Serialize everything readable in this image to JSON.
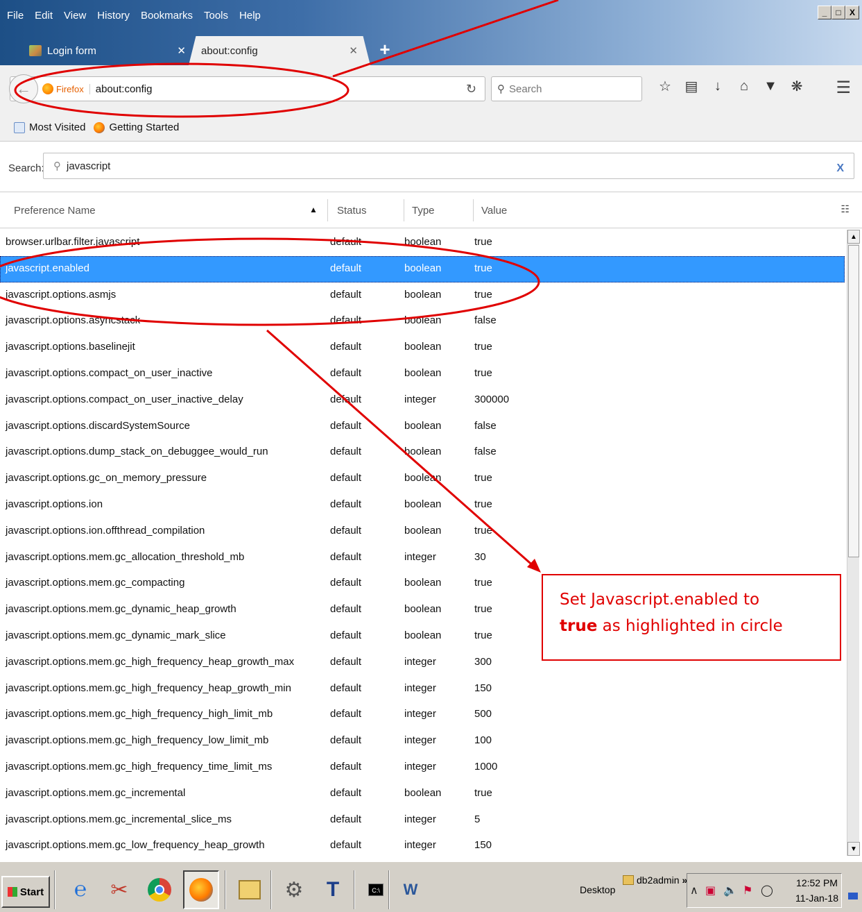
{
  "window": {
    "menus": [
      "File",
      "Edit",
      "View",
      "History",
      "Bookmarks",
      "Tools",
      "Help"
    ],
    "controls": [
      "_",
      "□",
      "X"
    ]
  },
  "tabs": [
    {
      "title": "Login form",
      "active": false
    },
    {
      "title": "about:config",
      "active": true
    }
  ],
  "navbar": {
    "identity_label": "Firefox",
    "url": "about:config",
    "search_placeholder": "Search"
  },
  "bookmarks": [
    "Most Visited",
    "Getting Started"
  ],
  "config_search": {
    "label": "Search:",
    "value": "javascript",
    "clear": "X"
  },
  "table": {
    "headers": {
      "name": "Preference Name",
      "status": "Status",
      "type": "Type",
      "value": "Value"
    },
    "selected_index": 1,
    "rows": [
      {
        "name": "browser.urlbar.filter.javascript",
        "status": "default",
        "type": "boolean",
        "value": "true"
      },
      {
        "name": "javascript.enabled",
        "status": "default",
        "type": "boolean",
        "value": "true"
      },
      {
        "name": "javascript.options.asmjs",
        "status": "default",
        "type": "boolean",
        "value": "true"
      },
      {
        "name": "javascript.options.asyncstack",
        "status": "default",
        "type": "boolean",
        "value": "false"
      },
      {
        "name": "javascript.options.baselinejit",
        "status": "default",
        "type": "boolean",
        "value": "true"
      },
      {
        "name": "javascript.options.compact_on_user_inactive",
        "status": "default",
        "type": "boolean",
        "value": "true"
      },
      {
        "name": "javascript.options.compact_on_user_inactive_delay",
        "status": "default",
        "type": "integer",
        "value": "300000"
      },
      {
        "name": "javascript.options.discardSystemSource",
        "status": "default",
        "type": "boolean",
        "value": "false"
      },
      {
        "name": "javascript.options.dump_stack_on_debuggee_would_run",
        "status": "default",
        "type": "boolean",
        "value": "false"
      },
      {
        "name": "javascript.options.gc_on_memory_pressure",
        "status": "default",
        "type": "boolean",
        "value": "true"
      },
      {
        "name": "javascript.options.ion",
        "status": "default",
        "type": "boolean",
        "value": "true"
      },
      {
        "name": "javascript.options.ion.offthread_compilation",
        "status": "default",
        "type": "boolean",
        "value": "true"
      },
      {
        "name": "javascript.options.mem.gc_allocation_threshold_mb",
        "status": "default",
        "type": "integer",
        "value": "30"
      },
      {
        "name": "javascript.options.mem.gc_compacting",
        "status": "default",
        "type": "boolean",
        "value": "true"
      },
      {
        "name": "javascript.options.mem.gc_dynamic_heap_growth",
        "status": "default",
        "type": "boolean",
        "value": "true"
      },
      {
        "name": "javascript.options.mem.gc_dynamic_mark_slice",
        "status": "default",
        "type": "boolean",
        "value": "true"
      },
      {
        "name": "javascript.options.mem.gc_high_frequency_heap_growth_max",
        "status": "default",
        "type": "integer",
        "value": "300"
      },
      {
        "name": "javascript.options.mem.gc_high_frequency_heap_growth_min",
        "status": "default",
        "type": "integer",
        "value": "150"
      },
      {
        "name": "javascript.options.mem.gc_high_frequency_high_limit_mb",
        "status": "default",
        "type": "integer",
        "value": "500"
      },
      {
        "name": "javascript.options.mem.gc_high_frequency_low_limit_mb",
        "status": "default",
        "type": "integer",
        "value": "100"
      },
      {
        "name": "javascript.options.mem.gc_high_frequency_time_limit_ms",
        "status": "default",
        "type": "integer",
        "value": "1000"
      },
      {
        "name": "javascript.options.mem.gc_incremental",
        "status": "default",
        "type": "boolean",
        "value": "true"
      },
      {
        "name": "javascript.options.mem.gc_incremental_slice_ms",
        "status": "default",
        "type": "integer",
        "value": "5"
      },
      {
        "name": "javascript.options.mem.gc_low_frequency_heap_growth",
        "status": "default",
        "type": "integer",
        "value": "150"
      }
    ]
  },
  "annotation": {
    "line1": "Set Javascript.enabled  to",
    "bold": "true",
    "line2_rest": " as highlighted in circle",
    "color": "#e00000"
  },
  "taskbar": {
    "start_label": "Start",
    "desktop_label": "Desktop",
    "user_label": "db2admin",
    "chevron": "»",
    "time": "12:52 PM",
    "date": "11-Jan-18"
  },
  "colors": {
    "selection": "#3399ff",
    "annotation_red": "#e00000"
  }
}
